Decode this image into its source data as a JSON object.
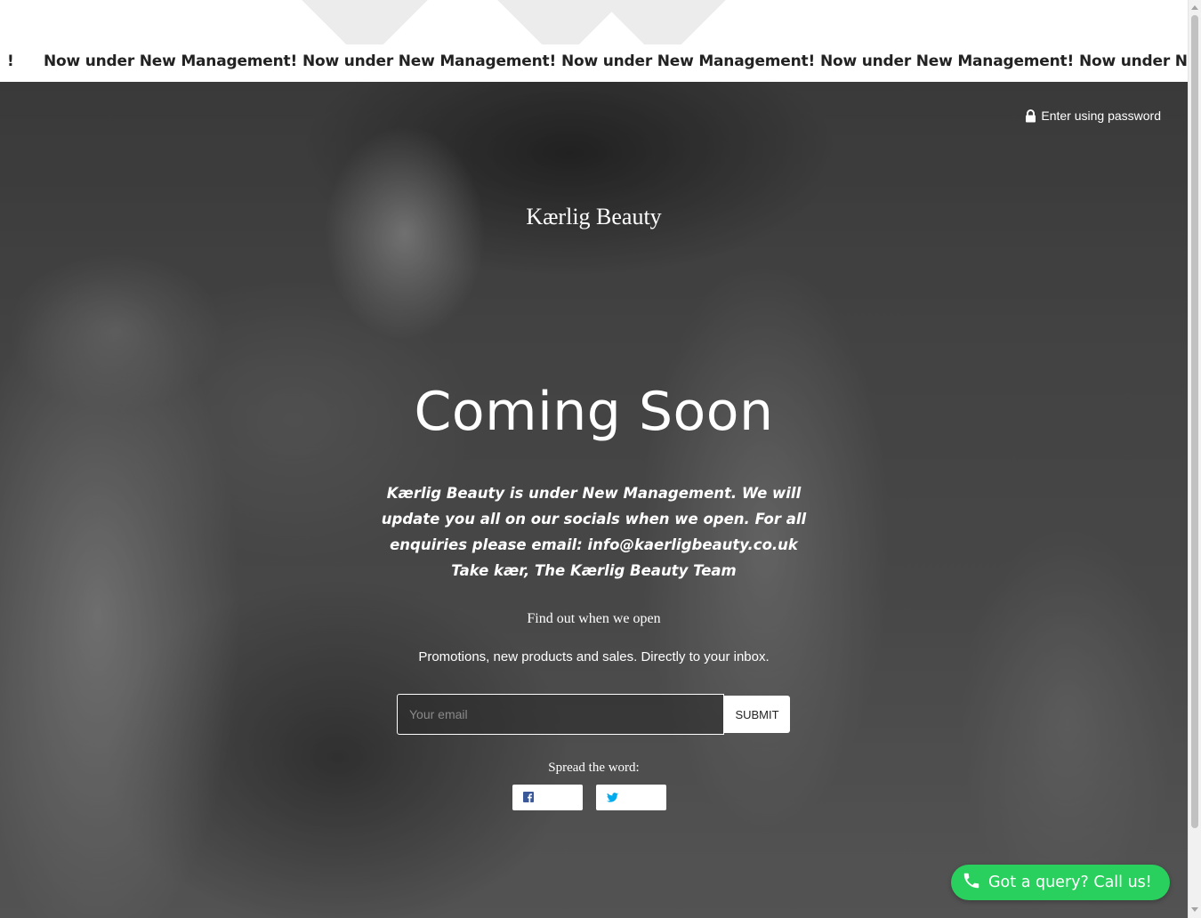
{
  "announcement": {
    "items": [
      "!",
      "Now under New Management!",
      "Now under New Management!",
      "Now under New Management!",
      "Now under New Management!",
      "Now under Ne"
    ]
  },
  "header": {
    "password_label": "Enter using password",
    "lock_icon": "lock-icon"
  },
  "brand": {
    "name": "Kærlig Beauty"
  },
  "hero": {
    "headline": "Coming Soon",
    "message": "Kærlig Beauty is under New Management. We will update you all on our socials when we open. For all enquiries please email: info@kaerligbeauty.co.uk Take kær, The Kærlig Beauty Team"
  },
  "signup": {
    "heading": "Find out when we open",
    "subheading": "Promotions, new products and sales. Directly to your inbox.",
    "email_placeholder": "Your email",
    "submit_label": "Submit"
  },
  "share": {
    "label": "Spread the word:",
    "buttons": [
      {
        "network": "facebook",
        "icon": "facebook-icon",
        "color": "#3b5998"
      },
      {
        "network": "twitter",
        "icon": "twitter-icon",
        "color": "#00aced"
      }
    ]
  },
  "call_widget": {
    "label": "Got a query? Call us!",
    "icon": "phone-icon",
    "color": "#29d05e"
  }
}
